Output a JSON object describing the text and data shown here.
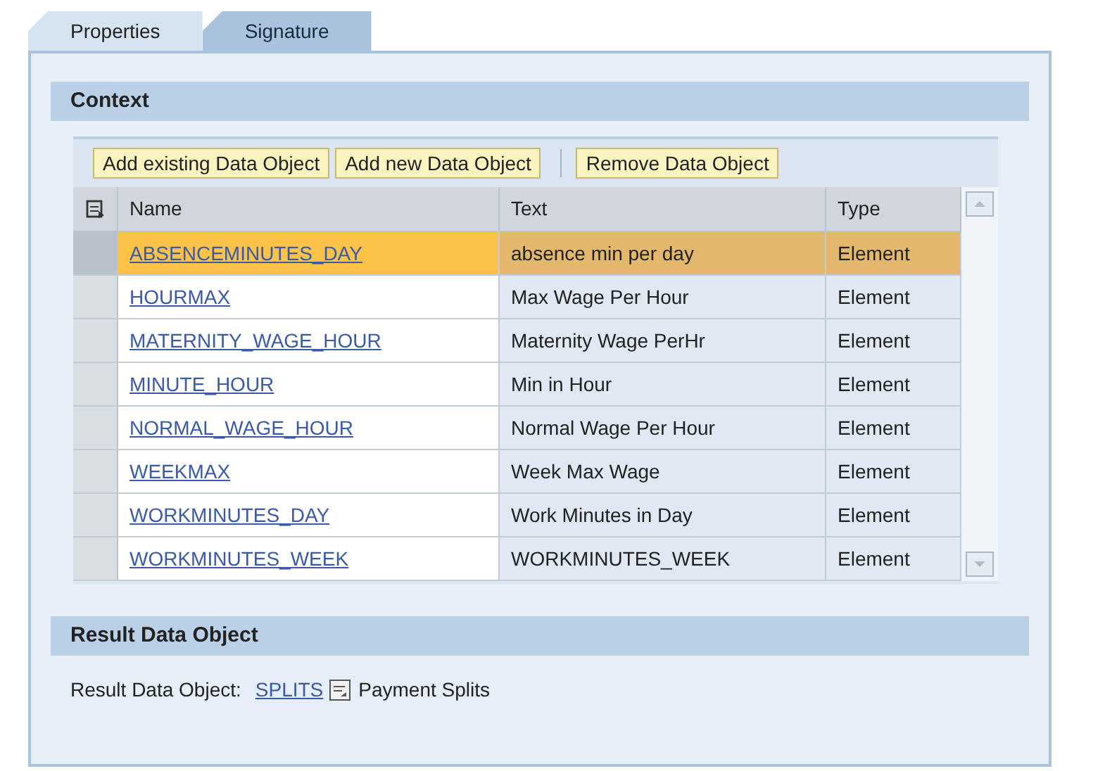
{
  "tabs": [
    {
      "label": "Properties",
      "selected": false
    },
    {
      "label": "Signature",
      "selected": true
    }
  ],
  "context": {
    "title": "Context",
    "buttons": [
      "Add existing Data Object",
      "Add new Data Object",
      "Remove Data Object"
    ],
    "table": {
      "columns": [
        "Name",
        "Text",
        "Type"
      ],
      "rows": [
        {
          "name": "ABSENCEMINUTES_DAY",
          "text": "absence min per day",
          "type": "Element",
          "selected": true
        },
        {
          "name": "HOURMAX",
          "text": "Max Wage Per Hour",
          "type": "Element",
          "selected": false
        },
        {
          "name": "MATERNITY_WAGE_HOUR",
          "text": "Maternity Wage PerHr",
          "type": "Element",
          "selected": false
        },
        {
          "name": "MINUTE_HOUR",
          "text": "Min in Hour",
          "type": "Element",
          "selected": false
        },
        {
          "name": "NORMAL_WAGE_HOUR",
          "text": "Normal Wage Per Hour",
          "type": "Element",
          "selected": false
        },
        {
          "name": "WEEKMAX",
          "text": "Week Max Wage",
          "type": "Element",
          "selected": false
        },
        {
          "name": "WORKMINUTES_DAY",
          "text": "Work Minutes in Day",
          "type": "Element",
          "selected": false
        },
        {
          "name": "WORKMINUTES_WEEK",
          "text": "WORKMINUTES_WEEK",
          "type": "Element",
          "selected": false
        }
      ]
    }
  },
  "result": {
    "title": "Result Data Object",
    "label": "Result Data Object:",
    "link": "SPLITS",
    "description": "Payment Splits"
  }
}
